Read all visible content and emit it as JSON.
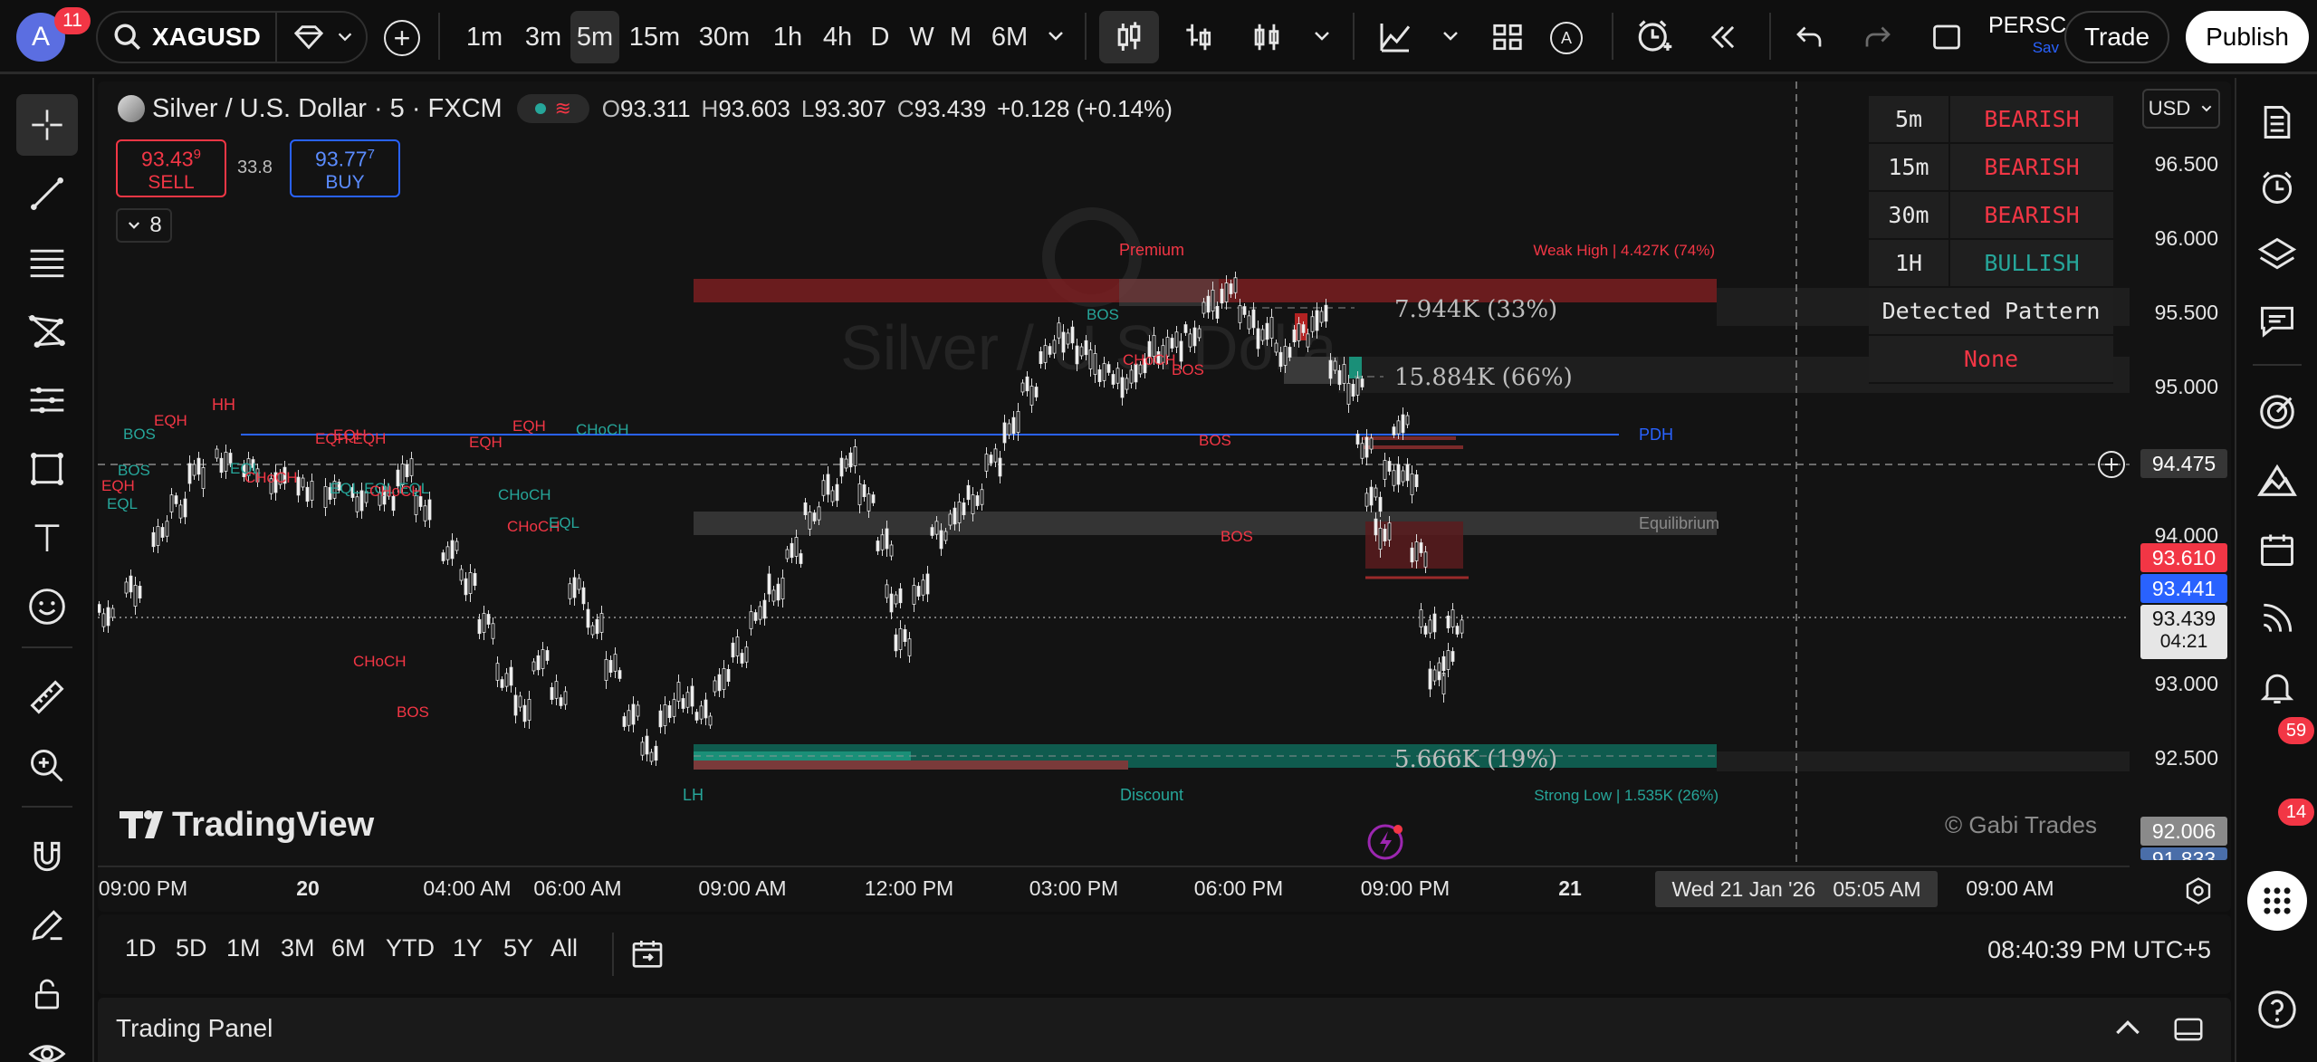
{
  "header": {
    "avatar_letter": "A",
    "notifications": "11",
    "symbol": "XAGUSD",
    "intervals": [
      "1m",
      "3m",
      "5m",
      "15m",
      "30m",
      "1h",
      "4h",
      "D",
      "W",
      "M",
      "6M"
    ],
    "active_interval": "5m",
    "layout_name": "PERSC",
    "layout_sub": "Sav",
    "trade_label": "Trade",
    "publish_label": "Publish"
  },
  "legend": {
    "title": "Silver / U.S. Dollar · 5 · FXCM",
    "open_l": "O",
    "open": "93.311",
    "high_l": "H",
    "high": "93.603",
    "low_l": "L",
    "low": "93.307",
    "close_l": "C",
    "close": "93.439",
    "change": "+0.128 (+0.14%)",
    "sell_price": "93.43",
    "sell_sup": "9",
    "sell_label": "SELL",
    "spread": "33.8",
    "buy_price": "93.77",
    "buy_sup": "7",
    "buy_label": "BUY",
    "indicators_count": "8"
  },
  "currency": "USD",
  "price_scale": [
    "96.500",
    "96.000",
    "95.500",
    "95.000",
    "94.000",
    "93.000",
    "92.500"
  ],
  "badges": {
    "crosshair": "94.475",
    "red": "93.610",
    "blue": "93.441",
    "last": "93.439",
    "countdown": "04:21",
    "grey": "92.006",
    "grey2": "91.833"
  },
  "time_scale": [
    "09:00 PM",
    "20",
    "04:00 AM",
    "06:00 AM",
    "09:00 AM",
    "12:00 PM",
    "03:00 PM",
    "06:00 PM",
    "09:00 PM",
    "21",
    "09:00 AM"
  ],
  "crosshair_time": "Wed 21 Jan '26   05:05 AM",
  "mtf_table": [
    {
      "tf": "5m",
      "trend": "BEARISH",
      "color": "#f23645"
    },
    {
      "tf": "15m",
      "trend": "BEARISH",
      "color": "#f23645"
    },
    {
      "tf": "30m",
      "trend": "BEARISH",
      "color": "#f23645"
    },
    {
      "tf": "1H",
      "trend": "BULLISH",
      "color": "#26a69a"
    }
  ],
  "pattern_header": "Detected Pattern",
  "pattern_value": "None",
  "annotations": {
    "premium": "Premium",
    "weak_high": "Weak High | 4.427K (74%)",
    "equilibrium": "Equilibrium",
    "discount": "Discount",
    "strong_low": "Strong Low | 1.535K (26%)",
    "pdh": "PDH",
    "vol1": "7.944K (33%)",
    "vol2": "15.884K (66%)",
    "vol3": "5.666K (19%)",
    "hh": "HH",
    "lh": "LH",
    "watermark": "Silver / U.S. Dolla",
    "copyright": "© Gabi Trades",
    "brand": "TradingView"
  },
  "smc_labels": [
    {
      "t": "BOS",
      "c": "#26a69a"
    },
    {
      "t": "EQH",
      "c": "#f23645"
    },
    {
      "t": "BOS",
      "c": "#26a69a"
    },
    {
      "t": "EQH",
      "c": "#f23645"
    },
    {
      "t": "EQL",
      "c": "#26a69a"
    },
    {
      "t": "CHoCH",
      "c": "#f23645"
    },
    {
      "t": "EQL EQL EQL",
      "c": "#26a69a"
    },
    {
      "t": "CHoCH",
      "c": "#f23645"
    },
    {
      "t": "EQH",
      "c": "#f23645"
    },
    {
      "t": "EQH EQH",
      "c": "#f23645"
    },
    {
      "t": "CHoCH",
      "c": "#26a69a"
    },
    {
      "t": "CHoCH",
      "c": "#f23645"
    },
    {
      "t": "BOS",
      "c": "#f23645"
    },
    {
      "t": "EQH",
      "c": "#f23645"
    },
    {
      "t": "CHoCH",
      "c": "#f23645"
    },
    {
      "t": "EQL",
      "c": "#26a69a"
    },
    {
      "t": "CHoCH",
      "c": "#26a69a"
    },
    {
      "t": "EQH",
      "c": "#f23645"
    },
    {
      "t": "BOS",
      "c": "#26a69a"
    },
    {
      "t": "CHoCH",
      "c": "#f23645"
    },
    {
      "t": "BOS",
      "c": "#f23645"
    },
    {
      "t": "BOS",
      "c": "#f23645"
    },
    {
      "t": "BOS",
      "c": "#f23645"
    },
    {
      "t": "EQL",
      "c": "#26a69a"
    }
  ],
  "date_ranges": [
    "1D",
    "5D",
    "1M",
    "3M",
    "6M",
    "YTD",
    "1Y",
    "5Y",
    "All"
  ],
  "clock": "08:40:39 PM UTC+5",
  "trading_panel": "Trading Panel",
  "right_badges": {
    "alerts": "59",
    "notifications": "14"
  }
}
